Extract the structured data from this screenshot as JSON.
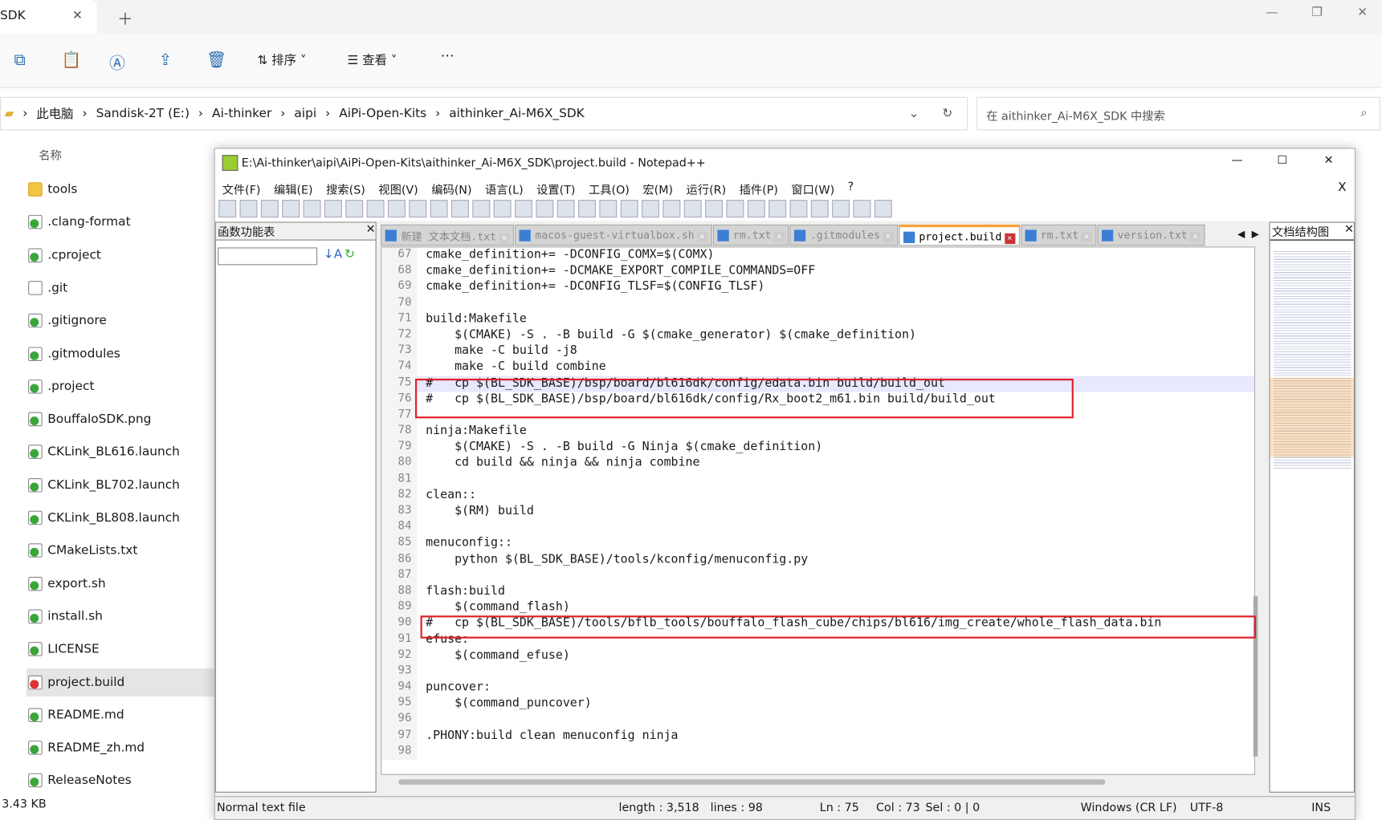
{
  "explorer": {
    "tab_title": "SDK",
    "toolbar": {
      "sort": "排序",
      "view": "查看",
      "more": "···"
    },
    "breadcrumb": [
      "此电脑",
      "Sandisk-2T (E:)",
      "Ai-thinker",
      "aipi",
      "AiPi-Open-Kits",
      "aithinker_Ai-M6X_SDK"
    ],
    "search_placeholder": "在 aithinker_Ai-M6X_SDK 中搜索",
    "column_name": "名称",
    "files": [
      {
        "name": "tools",
        "icon": "folder-icon"
      },
      {
        "name": ".clang-format",
        "icon": "file-icon"
      },
      {
        "name": ".cproject",
        "icon": "file-icon"
      },
      {
        "name": ".git",
        "icon": "blank-file-icon"
      },
      {
        "name": ".gitignore",
        "icon": "file-icon"
      },
      {
        "name": ".gitmodules",
        "icon": "file-icon"
      },
      {
        "name": ".project",
        "icon": "file-icon"
      },
      {
        "name": "BouffaloSDK.png",
        "icon": "file-icon"
      },
      {
        "name": "CKLink_BL616.launch",
        "icon": "file-icon"
      },
      {
        "name": "CKLink_BL702.launch",
        "icon": "file-icon"
      },
      {
        "name": "CKLink_BL808.launch",
        "icon": "file-icon"
      },
      {
        "name": "CMakeLists.txt",
        "icon": "file-icon"
      },
      {
        "name": "export.sh",
        "icon": "file-icon"
      },
      {
        "name": "install.sh",
        "icon": "file-icon"
      },
      {
        "name": "LICENSE",
        "icon": "file-icon"
      },
      {
        "name": "project.build",
        "icon": "file-modified-icon",
        "selected": true
      },
      {
        "name": "README.md",
        "icon": "file-icon"
      },
      {
        "name": "README_zh.md",
        "icon": "file-icon"
      },
      {
        "name": "ReleaseNotes",
        "icon": "file-icon"
      }
    ],
    "status_size": "3.43 KB"
  },
  "npp": {
    "title": "E:\\Ai-thinker\\aipi\\AiPi-Open-Kits\\aithinker_Ai-M6X_SDK\\project.build - Notepad++",
    "menu": [
      "文件(F)",
      "编辑(E)",
      "搜索(S)",
      "视图(V)",
      "编码(N)",
      "语言(L)",
      "设置(T)",
      "工具(O)",
      "宏(M)",
      "运行(R)",
      "插件(P)",
      "窗口(W)",
      "?"
    ],
    "close_doc": "X",
    "function_list_title": "函数功能表",
    "doc_map_title": "文档结构图",
    "tabs": [
      {
        "label": "新建 文本文档.txt"
      },
      {
        "label": "macos-guest-virtualbox.sh"
      },
      {
        "label": "rm.txt"
      },
      {
        "label": ".gitmodules"
      },
      {
        "label": "project.build",
        "active": true
      },
      {
        "label": "rm.txt"
      },
      {
        "label": "version.txt"
      }
    ],
    "lines": [
      {
        "n": "67",
        "t": "cmake_definition+= -DCONFIG_COMX=$(COMX)"
      },
      {
        "n": "68",
        "t": "cmake_definition+= -DCMAKE_EXPORT_COMPILE_COMMANDS=OFF"
      },
      {
        "n": "69",
        "t": "cmake_definition+= -DCONFIG_TLSF=$(CONFIG_TLSF)"
      },
      {
        "n": "70",
        "t": ""
      },
      {
        "n": "71",
        "t": "build:Makefile"
      },
      {
        "n": "72",
        "t": "    $(CMAKE) -S . -B build -G $(cmake_generator) $(cmake_definition)"
      },
      {
        "n": "73",
        "t": "    make -C build -j8"
      },
      {
        "n": "74",
        "t": "    make -C build combine"
      },
      {
        "n": "75",
        "t": "#   cp $(BL_SDK_BASE)/bsp/board/bl616dk/config/edata.bin build/build_out",
        "hl": true
      },
      {
        "n": "76",
        "t": "#   cp $(BL_SDK_BASE)/bsp/board/bl616dk/config/Rx_boot2_m61.bin build/build_out"
      },
      {
        "n": "77",
        "t": ""
      },
      {
        "n": "78",
        "t": "ninja:Makefile"
      },
      {
        "n": "79",
        "t": "    $(CMAKE) -S . -B build -G Ninja $(cmake_definition)"
      },
      {
        "n": "80",
        "t": "    cd build && ninja && ninja combine"
      },
      {
        "n": "81",
        "t": ""
      },
      {
        "n": "82",
        "t": "clean::"
      },
      {
        "n": "83",
        "t": "    $(RM) build"
      },
      {
        "n": "84",
        "t": ""
      },
      {
        "n": "85",
        "t": "menuconfig::"
      },
      {
        "n": "86",
        "t": "    python $(BL_SDK_BASE)/tools/kconfig/menuconfig.py"
      },
      {
        "n": "87",
        "t": ""
      },
      {
        "n": "88",
        "t": "flash:build"
      },
      {
        "n": "89",
        "t": "    $(command_flash)"
      },
      {
        "n": "90",
        "t": "#   cp $(BL_SDK_BASE)/tools/bflb_tools/bouffalo_flash_cube/chips/bl616/img_create/whole_flash_data.bin"
      },
      {
        "n": "91",
        "t": "efuse:"
      },
      {
        "n": "92",
        "t": "    $(command_efuse)"
      },
      {
        "n": "93",
        "t": ""
      },
      {
        "n": "94",
        "t": "puncover:"
      },
      {
        "n": "95",
        "t": "    $(command_puncover)"
      },
      {
        "n": "96",
        "t": ""
      },
      {
        "n": "97",
        "t": ".PHONY:build clean menuconfig ninja"
      },
      {
        "n": "98",
        "t": ""
      }
    ],
    "status": {
      "type": "Normal text file",
      "length": "length : 3,518",
      "lines": "lines : 98",
      "ln": "Ln : 75",
      "col": "Col : 73",
      "sel": "Sel : 0 | 0",
      "eol": "Windows (CR LF)",
      "enc": "UTF-8",
      "mode": "INS"
    },
    "highlight_color": "#e0202a"
  }
}
